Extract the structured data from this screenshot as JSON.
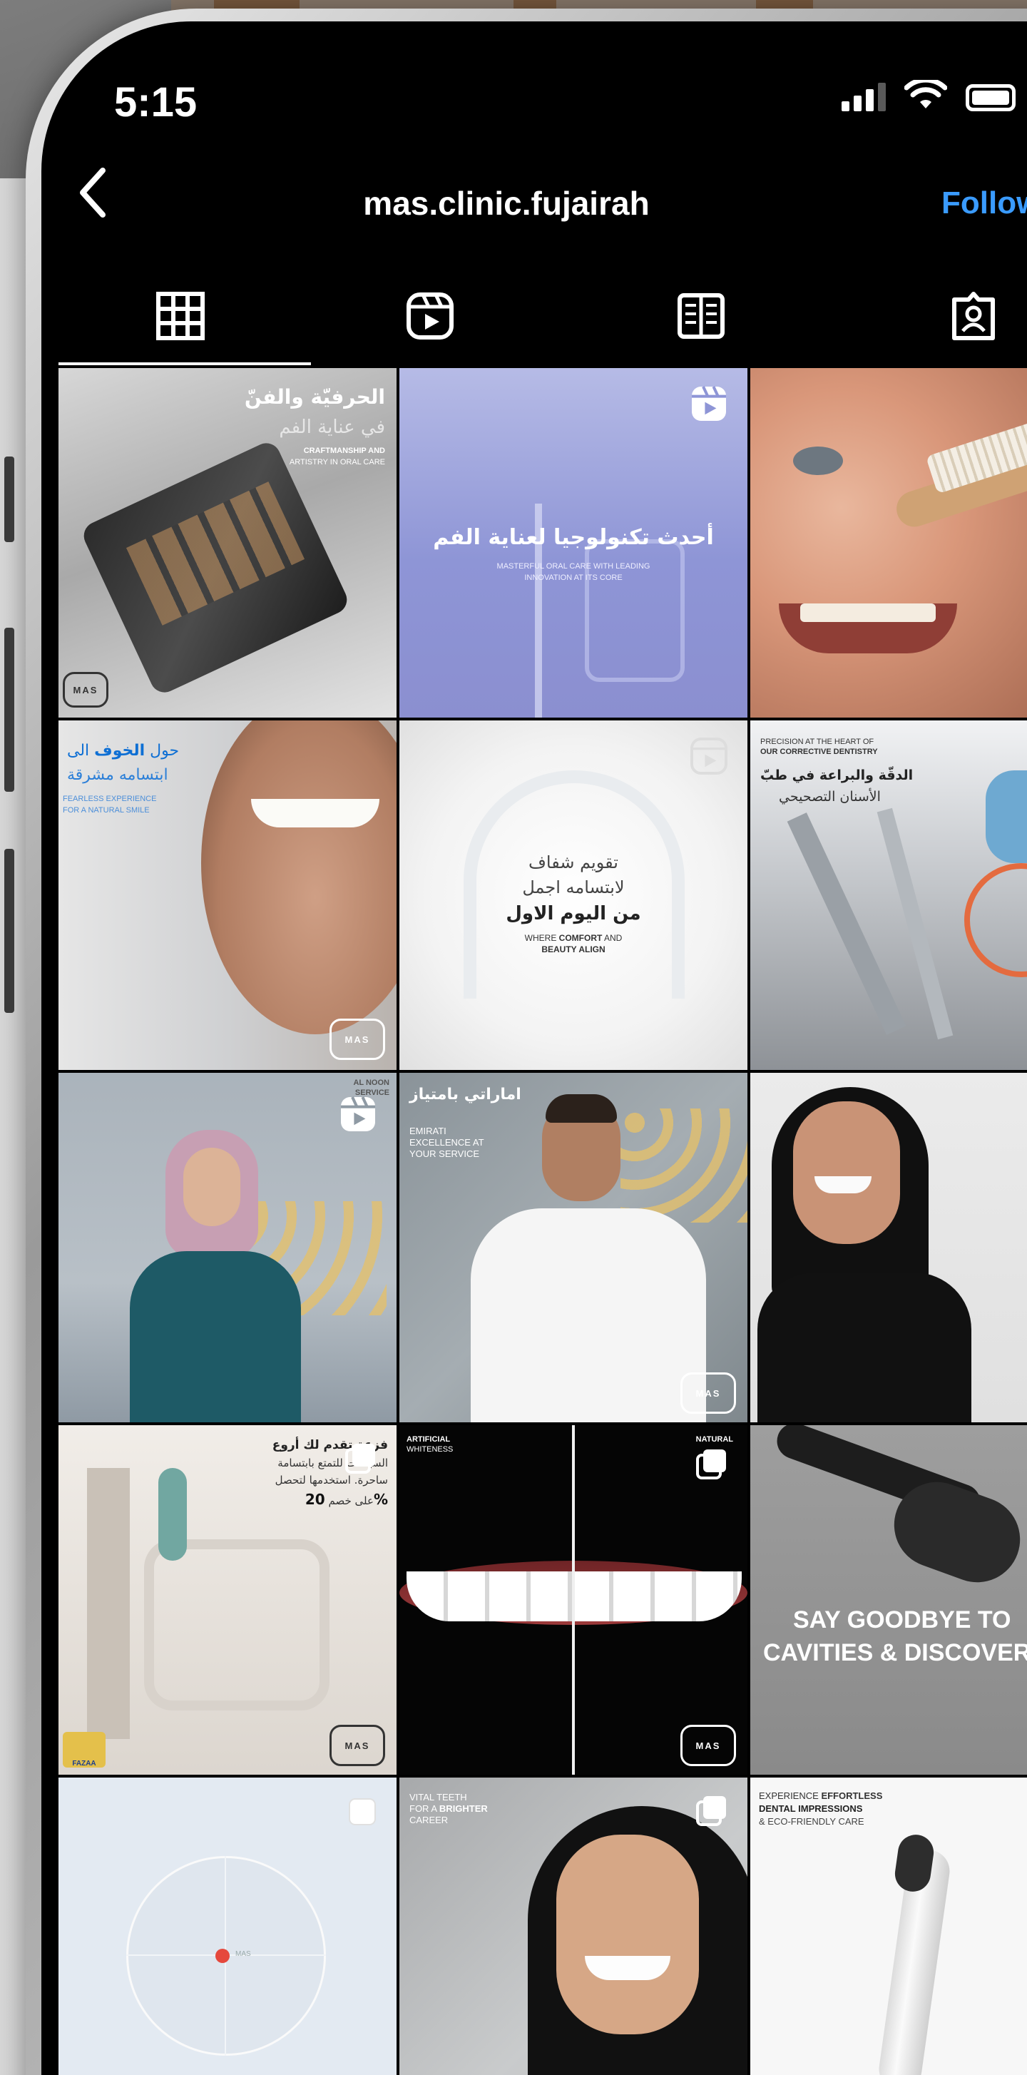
{
  "status_bar": {
    "time": "5:15"
  },
  "header": {
    "username": "mas.clinic.fujairah",
    "follow_label": "Follow"
  },
  "tabs": [
    {
      "name": "posts-grid",
      "icon": "grid-icon"
    },
    {
      "name": "reels",
      "icon": "reels-icon"
    },
    {
      "name": "guides",
      "icon": "guides-icon"
    },
    {
      "name": "tagged",
      "icon": "tagged-icon"
    }
  ],
  "posts": {
    "p1": {
      "title_ar": "الحرفيّة والفنّ",
      "subtitle_ar": "في عناية الفم",
      "caption_en_1": "CRAFTMANSHIP AND",
      "caption_en_2": "ARTISTRY IN ORAL CARE",
      "logo": "MAS"
    },
    "p2": {
      "title_ar": "أحدث تكنولوجيا لعناية الفم",
      "caption_en_1": "MASTERFUL ORAL CARE WITH LEADING",
      "caption_en_2": "INNOVATION AT ITS CORE"
    },
    "p4": {
      "line1_prefix": "حول",
      "line1_highlight": "الخوف",
      "line1_suffix": "الى",
      "line2": "ابتسامه مشرقة",
      "caption_en_1": "FEARLESS EXPERIENCE",
      "caption_en_2": "FOR A NATURAL SMILE",
      "logo": "MAS"
    },
    "p5": {
      "line1": "تقويم شفاف",
      "line2": "لابتسامه اجمل",
      "line3": "من اليوم الاول",
      "caption_en_prefix": "WHERE",
      "caption_en_bold": "COMFORT",
      "caption_en_suffix": "AND",
      "caption_en_2": "BEAUTY ALIGN"
    },
    "p6": {
      "caption_en_1": "PRECISION AT THE HEART OF",
      "caption_en_2": "OUR CORRECTIVE DENTISTRY",
      "title_ar": "الدقّة والبراعة في طبّ",
      "subtitle_ar": "الأسنان التصحيحي"
    },
    "p7": {
      "corner_text_1": "AL NOON",
      "corner_text_2": "SERVICE"
    },
    "p8": {
      "title_ar": "اماراتي بامتياز",
      "caption_en_1": "EMIRATI",
      "caption_en_2": "EXCELLENCE AT",
      "caption_en_3": "YOUR SERVICE",
      "logo": "MAS"
    },
    "p10": {
      "title_ar": "فزعة تقدم لك أروع",
      "line2_ar": "السيلانات للتمتع بابتسامة",
      "line3_ar": "ساحرة. استخدمها لتحصل",
      "line4_prefix": "على خصم",
      "discount": "20%",
      "badge_en": "FAZAA",
      "logo": "MAS"
    },
    "p11": {
      "left_label_1": "ARTIFICIAL",
      "left_label_2": "WHITENESS",
      "right_label": "NATURAL",
      "logo": "MAS"
    },
    "p12": {
      "line1": "SAY GOODBYE TO",
      "line2": "CAVITIES & DISCOVER"
    },
    "p13": {
      "dot_label": "MAS"
    },
    "p14": {
      "caption_1_light": "VITAL",
      "caption_1_rest": "TEETH",
      "caption_2_light": "FOR A",
      "caption_2_bold": "BRIGHTER",
      "caption_3": "CAREER"
    },
    "p15": {
      "line1_light": "EXPERIENCE",
      "line1_bold": "EFFORTLESS",
      "line2": "DENTAL IMPRESSIONS",
      "line3": "& ECO-FRIENDLY CARE"
    }
  }
}
